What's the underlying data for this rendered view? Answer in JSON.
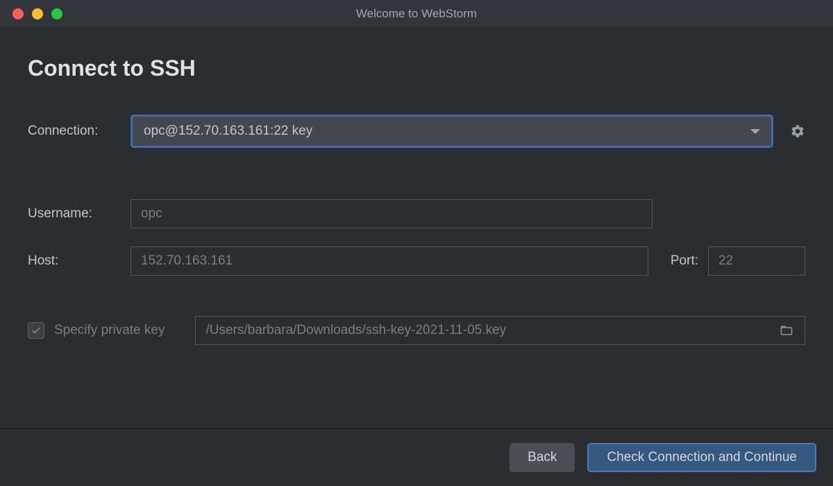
{
  "window": {
    "title": "Welcome to WebStorm"
  },
  "page": {
    "title": "Connect to SSH"
  },
  "form": {
    "connection_label": "Connection:",
    "connection_value": "opc@152.70.163.161:22 key",
    "username_label": "Username:",
    "username_value": "opc",
    "host_label": "Host:",
    "host_value": "152.70.163.161",
    "port_label": "Port:",
    "port_value": "22",
    "private_key_label": "Specify private key",
    "private_key_checked": true,
    "private_key_path": "/Users/barbara/Downloads/ssh-key-2021-11-05.key"
  },
  "footer": {
    "back_label": "Back",
    "continue_label": "Check Connection and Continue"
  }
}
